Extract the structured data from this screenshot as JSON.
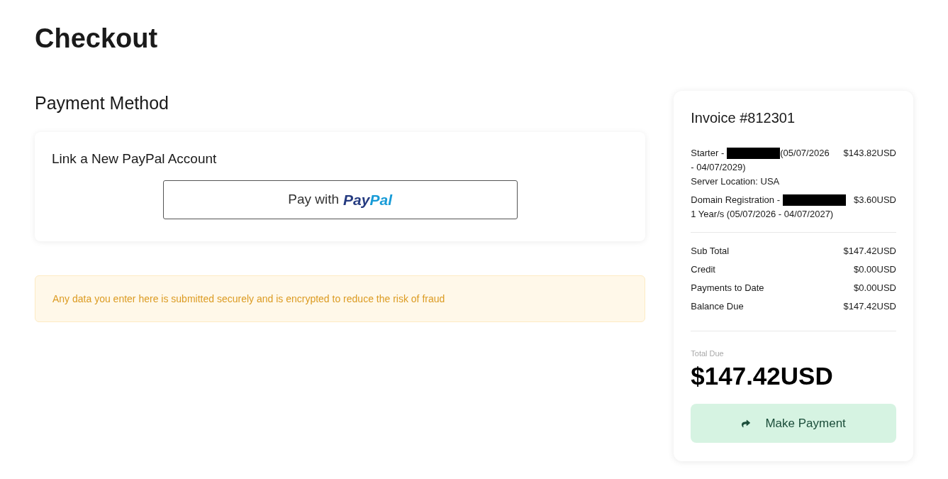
{
  "page": {
    "title": "Checkout"
  },
  "payment": {
    "heading": "Payment Method",
    "card_title": "Link a New PayPal Account",
    "button": {
      "label": "Pay with",
      "logo_parts": [
        "Pay",
        "Pal"
      ]
    },
    "notice": "Any data you enter here is submitted securely and is encrypted to reduce the risk of fraud"
  },
  "invoice": {
    "title": "Invoice #812301",
    "items": [
      {
        "label": "Starter -",
        "redacted": true,
        "label_tail": "(05/07/2026",
        "detail_lines": [
          "- 04/07/2029)",
          "Server Location: USA"
        ],
        "amount": "$143.82USD"
      },
      {
        "label": "Domain Registration -",
        "redacted": true,
        "detail_lines": [
          "1 Year/s (05/07/2026 - 04/07/2027)"
        ],
        "amount": "$3.60USD"
      }
    ],
    "totals": [
      {
        "label": "Sub Total",
        "value": "$147.42USD"
      },
      {
        "label": "Credit",
        "value": "$0.00USD"
      },
      {
        "label": "Payments to Date",
        "value": "$0.00USD"
      },
      {
        "label": "Balance Due",
        "value": "$147.42USD"
      }
    ],
    "total_due": {
      "label": "Total Due",
      "value": "$147.42USD"
    },
    "action": "Make Payment"
  }
}
